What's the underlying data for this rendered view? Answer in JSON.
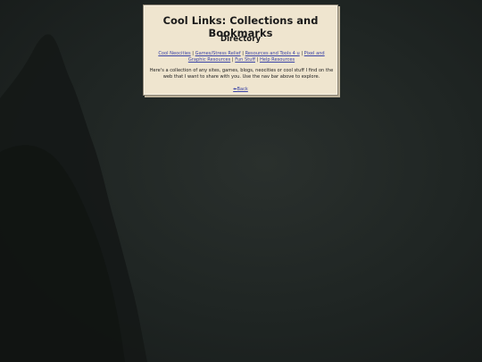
{
  "page": {
    "site_title": "Cool Links: Collections and Bookmarks",
    "section_title": "Directory"
  },
  "nav": {
    "items": [
      {
        "label": "Cool Neocities"
      },
      {
        "label": "Games/Stress Relief"
      },
      {
        "label": "Resources and Tools 4 u"
      },
      {
        "label": "Pixel and Graphic Resources"
      },
      {
        "label": "Fun Stuff"
      },
      {
        "label": "Help Resources"
      }
    ],
    "separator": "|"
  },
  "intro": {
    "text": "Here's a collection of any sites, games, blogs, neocities or cool stuff I find on the web that I want to share with you. Use the nav bar above to explore."
  },
  "back": {
    "label": "Back",
    "icon": "left-arrow-icon"
  },
  "colors": {
    "background": "#1f2523",
    "panel": "#efe5cf",
    "link": "#3b44a6"
  }
}
